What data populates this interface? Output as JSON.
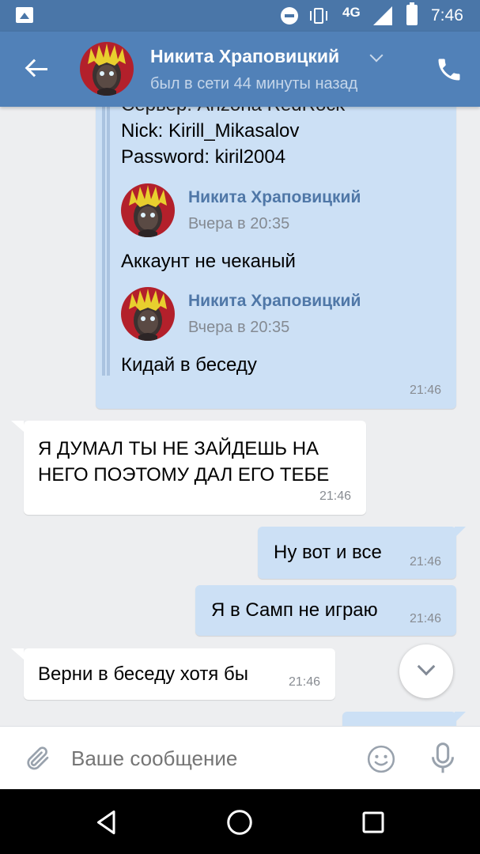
{
  "status_bar": {
    "network": "4G",
    "time": "7:46"
  },
  "header": {
    "contact_name": "Никита Храповицкий",
    "presence": "был в сети 44 минуты назад"
  },
  "forwarded": {
    "partial_top": "Сервер: Arizona RedRock",
    "lines": [
      "Nick: Kirill_Mikasalov",
      "Password: kiril2004"
    ],
    "items": [
      {
        "author": "Никита Храповицкий",
        "date": "Вчера в 20:35",
        "text": "Аккаунт не чеканый"
      },
      {
        "author": "Никита Храповицкий",
        "date": "Вчера в 20:35",
        "text": "Кидай в беседу"
      }
    ],
    "time": "21:46"
  },
  "messages": [
    {
      "direction": "in",
      "lines": [
        "Я ДУМАЛ ТЫ НЕ ЗАЙДЕШЬ НА",
        "НЕГО ПОЭТОМУ ДАЛ ЕГО ТЕБЕ"
      ],
      "time": "21:46"
    },
    {
      "direction": "out",
      "text": "Ну вот и все",
      "time": "21:46"
    },
    {
      "direction": "out",
      "text": "Я в Самп не играю",
      "time": "21:46"
    },
    {
      "direction": "in",
      "text": "Верни в беседу хотя бы",
      "time": "21:46"
    }
  ],
  "composer": {
    "placeholder": "Ваше сообщение"
  },
  "colors": {
    "header": "#5181b8",
    "status_bar": "#4a76a8",
    "outgoing_bubble": "#cce0f5",
    "link": "#4f77a7"
  },
  "icons": [
    "gallery-icon",
    "dnd-icon",
    "vibrate-icon",
    "signal-icon",
    "battery-icon",
    "back-arrow-icon",
    "chevron-down-icon",
    "phone-icon",
    "attach-icon",
    "emoji-icon",
    "mic-icon",
    "nav-back-icon",
    "nav-home-icon",
    "nav-recents-icon"
  ]
}
